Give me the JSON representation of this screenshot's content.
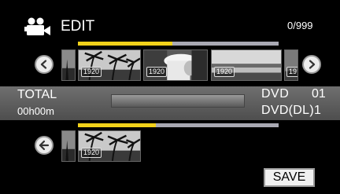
{
  "header": {
    "mode_icon": "video-camera-icon",
    "title": "EDIT",
    "counter": "0/999"
  },
  "top_progress": {
    "fraction": 0.47
  },
  "bottom_progress": {
    "fraction": 0.39
  },
  "thumbnails": {
    "top_row": [
      {
        "label": "1920",
        "scene": "palm-trees"
      },
      {
        "label": "1920",
        "scene": "person-white-hat"
      },
      {
        "label": "1920",
        "scene": "dusk-lake"
      },
      {
        "label": "19",
        "scene": "partial"
      }
    ],
    "bottom_row": [
      {
        "label": "1920",
        "scene": "palm-trees"
      }
    ]
  },
  "info": {
    "total_label": "TOTAL",
    "total_time": "00h00m",
    "disc_type": "DVD",
    "disc_count": "01",
    "disc_dl": "DVD(DL)1"
  },
  "buttons": {
    "prev_icon": "chevron-left-icon",
    "next_icon": "chevron-right-icon",
    "back_icon": "arrow-left-icon",
    "save_label": "SAVE"
  }
}
